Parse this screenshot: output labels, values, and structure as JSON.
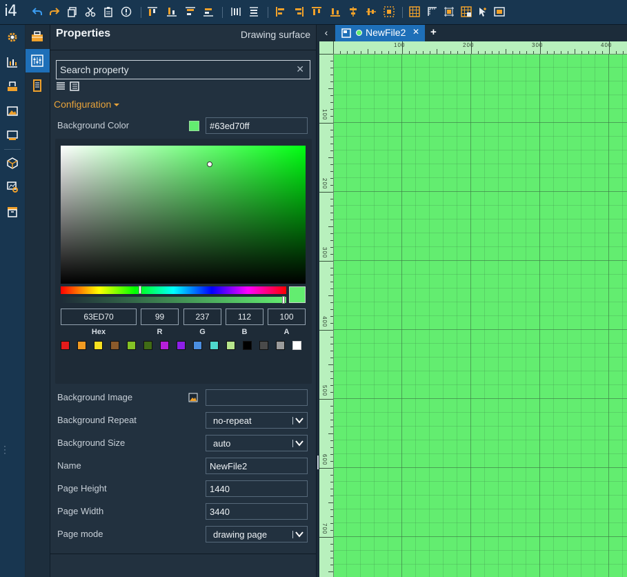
{
  "app": {
    "logo": "i4"
  },
  "panel": {
    "title": "Properties",
    "subtitle": "Drawing surface",
    "search_placeholder": "Search property",
    "section": "Configuration",
    "background_color": {
      "label": "Background Color",
      "value": "#63ed70ff",
      "swatch": "#63ed70"
    },
    "picker": {
      "hex": "63ED70",
      "r": "99",
      "g": "237",
      "b": "112",
      "a": "100",
      "labels": {
        "hex": "Hex",
        "r": "R",
        "g": "G",
        "b": "B",
        "a": "A"
      },
      "presets": [
        "#e31b1b",
        "#f19b22",
        "#f7e120",
        "#8b5a2b",
        "#84c225",
        "#406b15",
        "#b51fd8",
        "#8d1fe8",
        "#4a8ee0",
        "#4fd9cc",
        "#b7e58c",
        "#000000",
        "#4a4a4a",
        "#9b9b9b",
        "#ffffff"
      ]
    },
    "rows": {
      "bg_image_label": "Background Image",
      "bg_repeat_label": "Background Repeat",
      "bg_repeat_value": "no-repeat",
      "bg_size_label": "Background Size",
      "bg_size_value": "auto",
      "name_label": "Name",
      "name_value": "NewFile2",
      "page_height_label": "Page Height",
      "page_height_value": "1440",
      "page_width_label": "Page Width",
      "page_width_value": "3440",
      "page_mode_label": "Page mode",
      "page_mode_value": "drawing page"
    }
  },
  "tabs": [
    {
      "label": "NewFile2"
    }
  ],
  "canvas": {
    "color": "#63ed70",
    "ruler_top": [
      "100",
      "200",
      "300",
      "400"
    ],
    "ruler_left": [
      "100",
      "200",
      "300",
      "400",
      "500",
      "600",
      "700"
    ]
  }
}
